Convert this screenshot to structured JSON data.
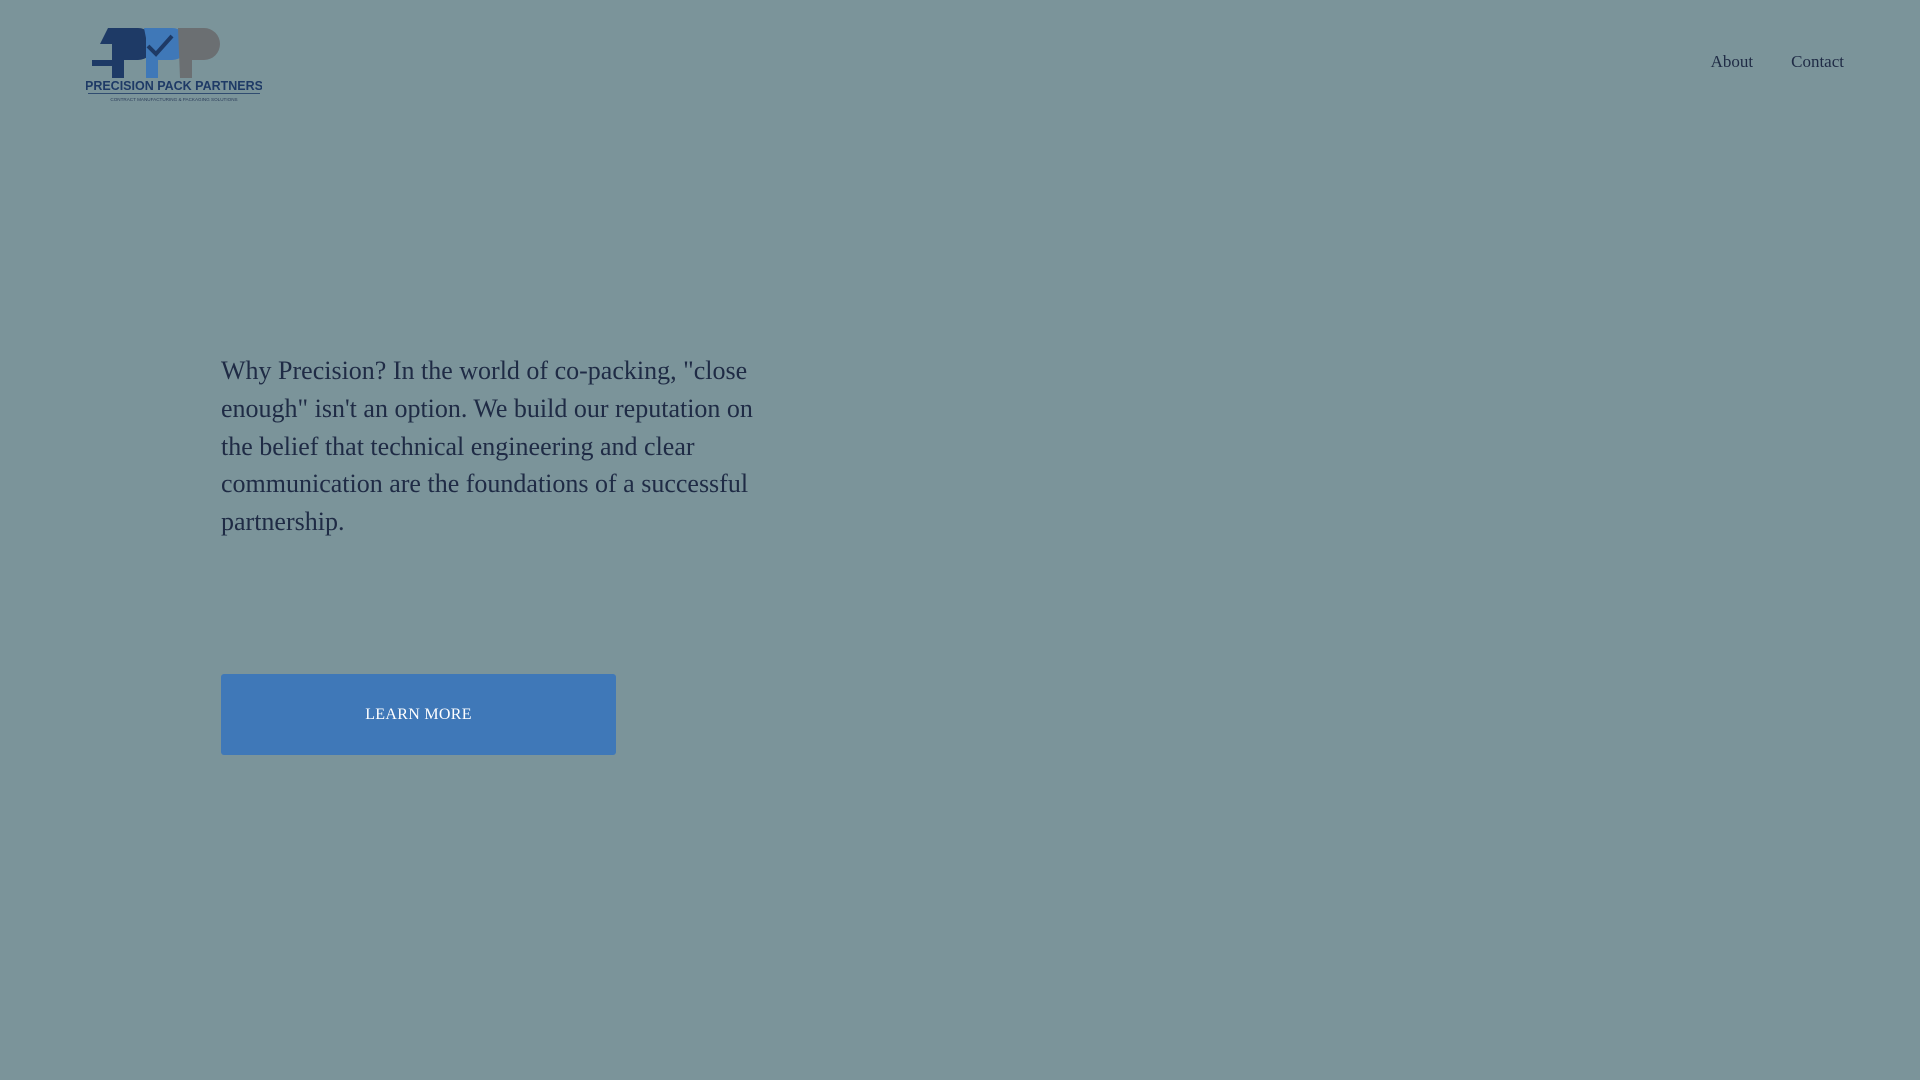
{
  "logo": {
    "name": "PRECISION PACK PARTNERS",
    "tagline": "CONTRACT MANUFACTURING & PACKAGING SOLUTIONS",
    "monogram": "PPP"
  },
  "nav": {
    "items": [
      {
        "label": "About"
      },
      {
        "label": "Contact"
      }
    ]
  },
  "hero": {
    "text": "Why Precision? In the world of co-packing, \"close enough\" isn't an option. We build our reputation on the belief that technical engineering and clear communication are the foundations of a successful partnership.",
    "button_label": "LEARN MORE"
  },
  "colors": {
    "background": "#7b949a",
    "accent": "#3f78b8",
    "text": "#1f2b45"
  }
}
